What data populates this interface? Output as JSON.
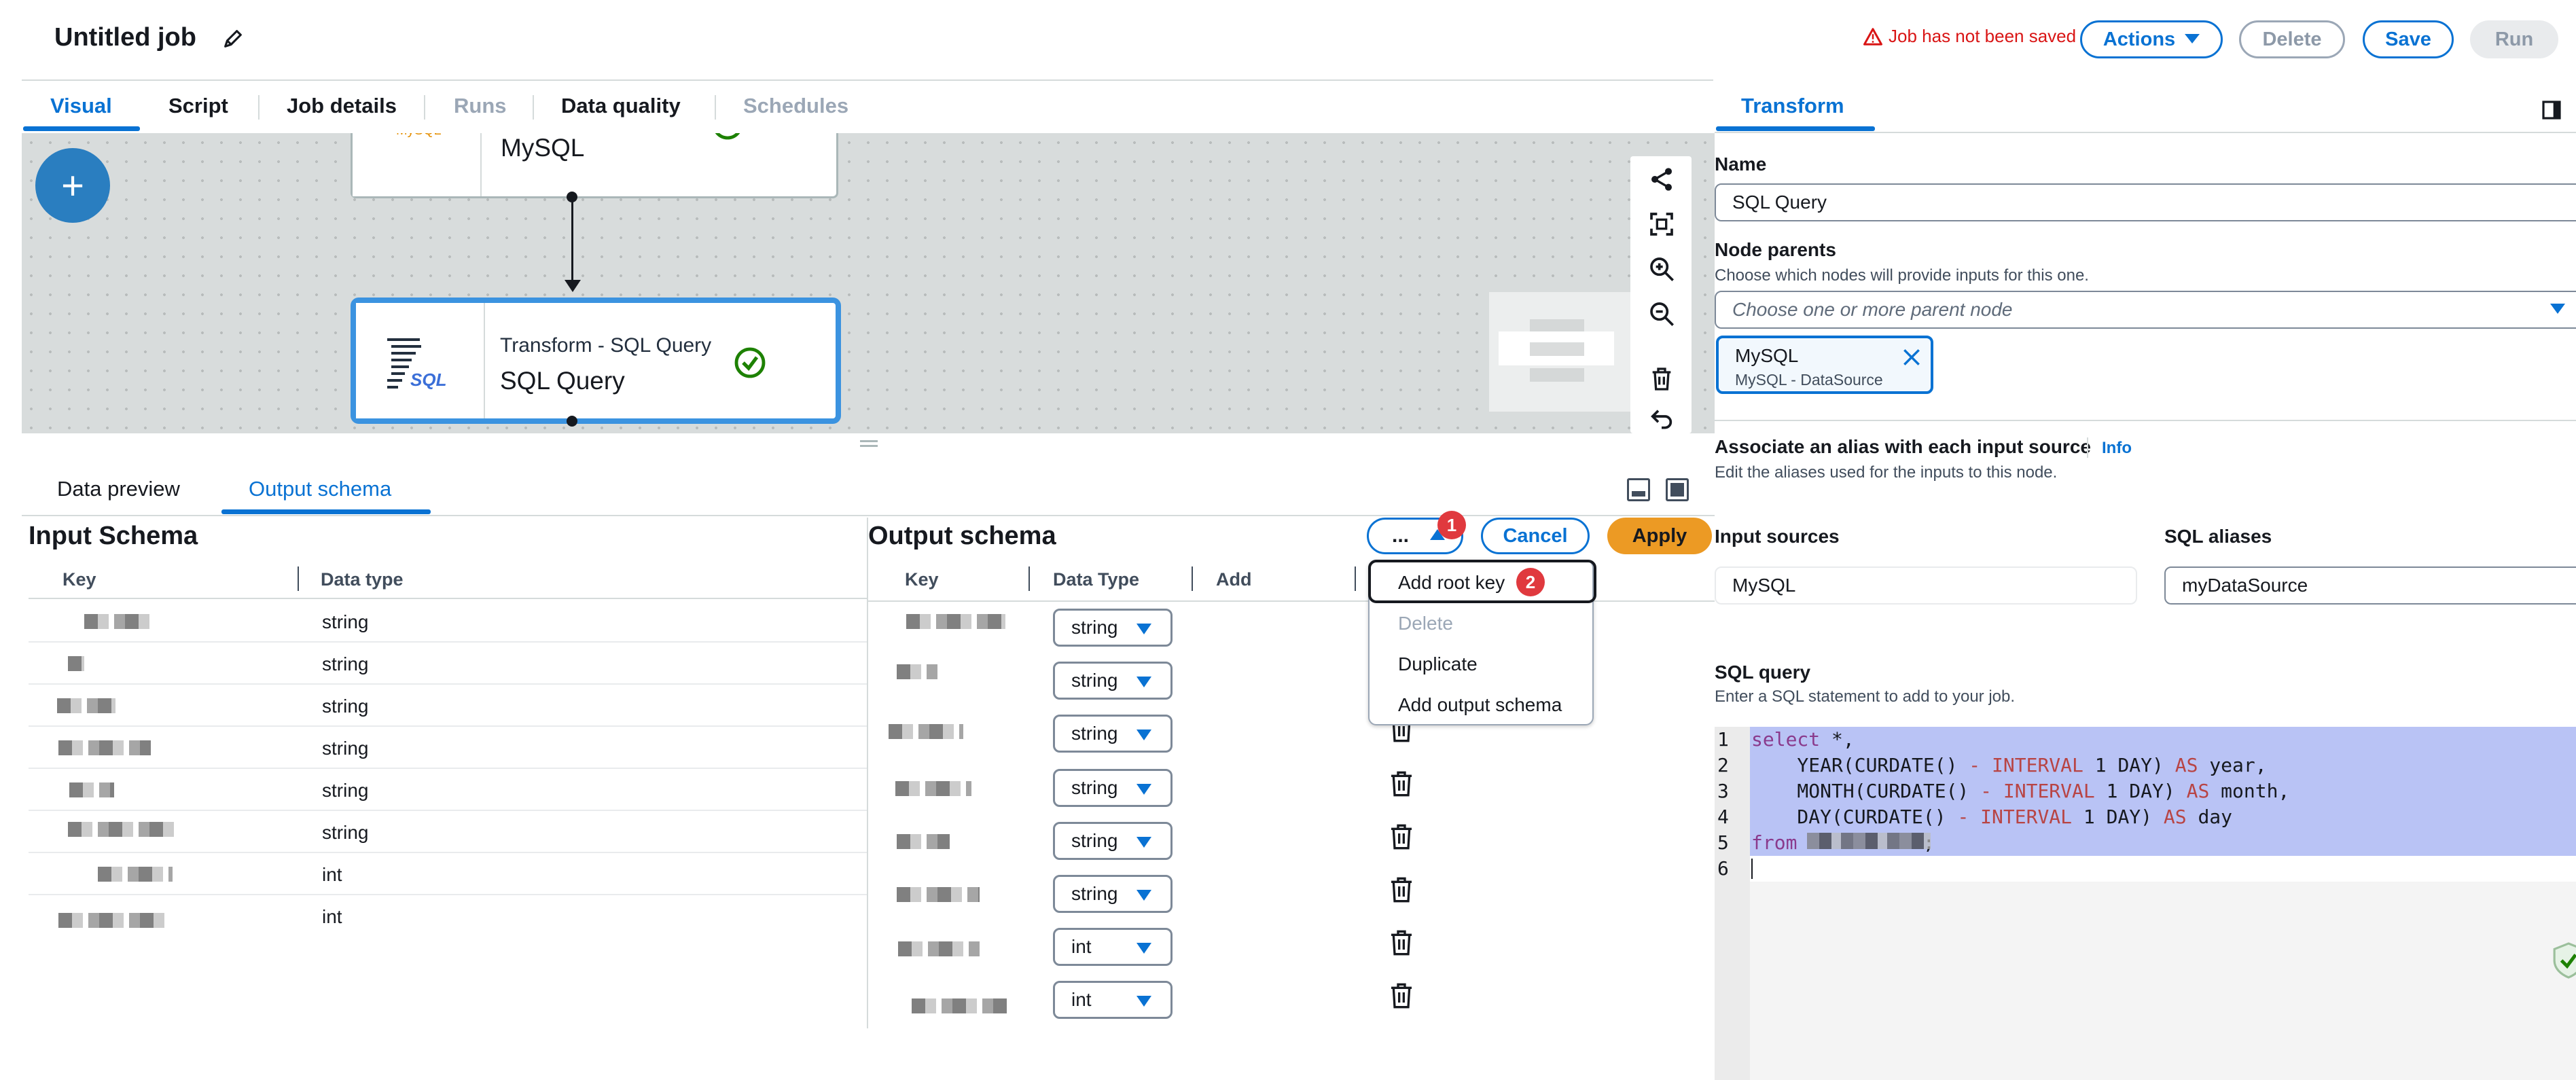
{
  "header": {
    "title": "Untitled job",
    "warning": "Job has not been saved",
    "actions_label": "Actions",
    "delete_label": "Delete",
    "save_label": "Save",
    "run_label": "Run"
  },
  "tabs": [
    {
      "label": "Visual"
    },
    {
      "label": "Script"
    },
    {
      "label": "Job details"
    },
    {
      "label": "Runs"
    },
    {
      "label": "Data quality"
    },
    {
      "label": "Schedules"
    }
  ],
  "canvas": {
    "add_label": "+",
    "nodes": [
      {
        "logo": "MySQL",
        "type_label": "",
        "name": "MySQL"
      },
      {
        "logo": "SQL",
        "type_label": "Transform - SQL Query",
        "name": "SQL Query"
      }
    ]
  },
  "bottom_tabs": [
    {
      "label": "Data preview"
    },
    {
      "label": "Output schema"
    }
  ],
  "input_schema": {
    "title": "Input Schema",
    "columns": [
      "Key",
      "Data type"
    ],
    "rows": [
      {
        "type": "string"
      },
      {
        "type": "string"
      },
      {
        "type": "string"
      },
      {
        "type": "string"
      },
      {
        "type": "string"
      },
      {
        "type": "string"
      },
      {
        "type": "int"
      },
      {
        "type": "int"
      }
    ]
  },
  "output_schema": {
    "title": "Output schema",
    "columns": [
      "Key",
      "Data Type",
      "Add"
    ],
    "more_label": "...",
    "cancel_label": "Cancel",
    "apply_label": "Apply",
    "badge1": "1",
    "badge2": "2",
    "rows": [
      {
        "type": "string"
      },
      {
        "type": "string"
      },
      {
        "type": "string"
      },
      {
        "type": "string"
      },
      {
        "type": "string"
      },
      {
        "type": "string"
      },
      {
        "type": "int"
      },
      {
        "type": "int"
      }
    ],
    "menu": [
      "Add root key",
      "Delete",
      "Duplicate",
      "Add output schema"
    ]
  },
  "transform": {
    "tab": "Transform",
    "name_label": "Name",
    "name_value": "SQL Query",
    "parents_label": "Node parents",
    "parents_desc": "Choose which nodes will provide inputs for this one.",
    "parents_placeholder": "Choose one or more parent node",
    "parent_token_name": "MySQL",
    "parent_token_sub": "MySQL - DataSource",
    "alias_label": "Associate an alias with each input source",
    "alias_info": "Info",
    "alias_desc": "Edit the aliases used for the inputs to this node.",
    "input_sources_label": "Input sources",
    "sql_aliases_label": "SQL aliases",
    "input_source_value": "MySQL",
    "sql_alias_value": "myDataSource",
    "sql_query_label": "SQL query",
    "sql_query_desc": "Enter a SQL statement to add to your job.",
    "code_lines": [
      "1",
      "2",
      "3",
      "4",
      "5",
      "6"
    ]
  },
  "colors": {
    "accent": "#0972d3",
    "apply": "#ec9a24",
    "error": "#d91515",
    "success": "#1d8102"
  }
}
